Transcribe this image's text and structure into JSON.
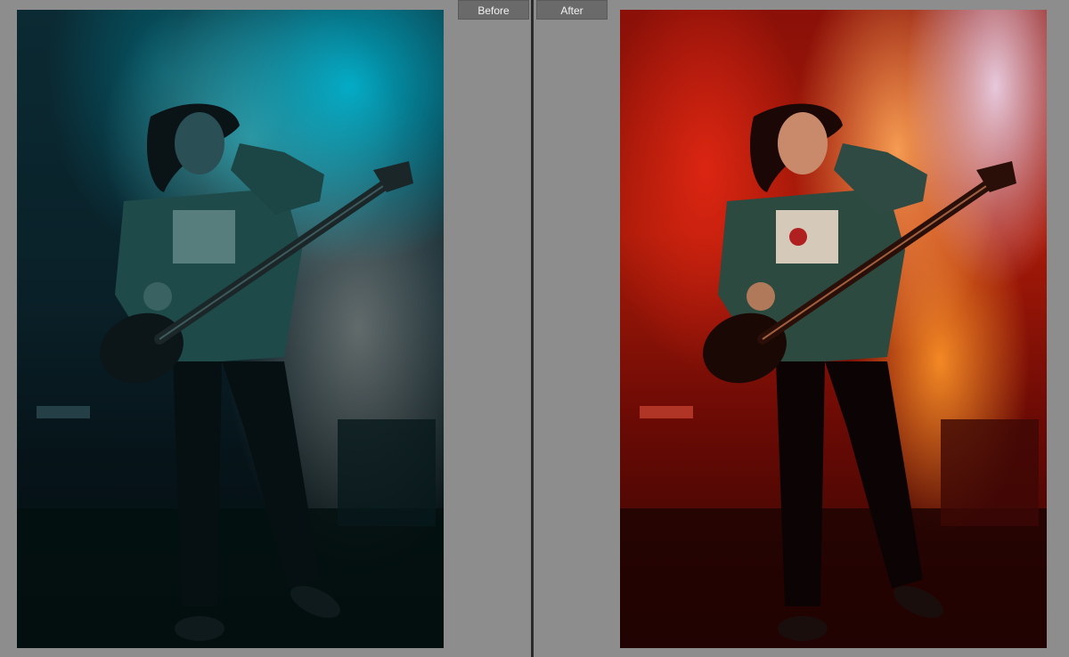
{
  "labels": {
    "before": "Before",
    "after": "After"
  },
  "photos": {
    "before": {
      "subject": "bassist-on-stage",
      "tone": "cool-teal"
    },
    "after": {
      "subject": "bassist-on-stage",
      "tone": "warm-red-orange"
    }
  },
  "colors": {
    "background": "#8d8d8d",
    "divider": "#2b2b2b",
    "tab": "#6a6a6a",
    "tab_text": "#f2f2f2"
  }
}
